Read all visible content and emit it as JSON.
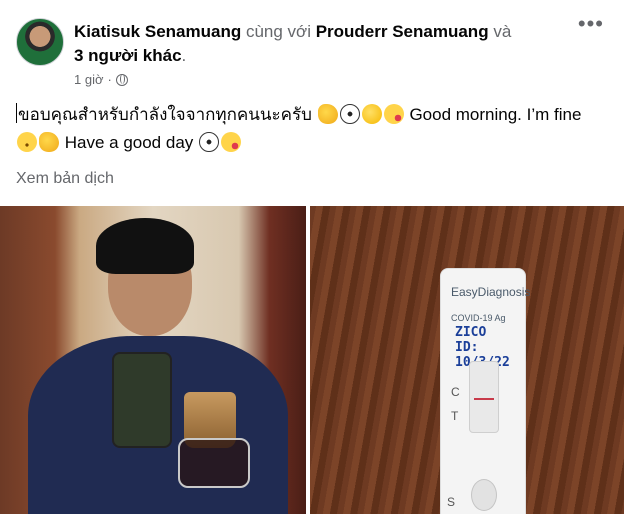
{
  "post": {
    "author": "Kiatisuk Senamuang",
    "with_word": "cùng với",
    "tagged": "Prouderr Senamuang",
    "and_word": "và",
    "others": "3 người khác",
    "period": ".",
    "time": "1 giờ",
    "separator": "·",
    "more_icon": "•••",
    "message": {
      "part1": "ขอบคุณสำหรับกำลังใจจากทุกคนนะครับ",
      "part2": "Good morning. I’m fine",
      "part3": "Have a good day"
    },
    "translate": "Xem bản dịch"
  },
  "photo_test": {
    "brand": "EasyDiagnosis",
    "product": "COVID-19 Ag",
    "handwritten_name": "ZICO",
    "handwritten_id": "ID: 10/3/22",
    "control_mark": "C",
    "test_mark": "T",
    "sample_mark": "S"
  },
  "icons": {
    "globe": "globe-icon",
    "muscle": "flexed-biceps-emoji",
    "ball": "soccer-ball-emoji",
    "think": "thinking-face-emoji",
    "kiss": "face-blowing-kiss-emoji",
    "smile": "slightly-smiling-face-emoji"
  }
}
